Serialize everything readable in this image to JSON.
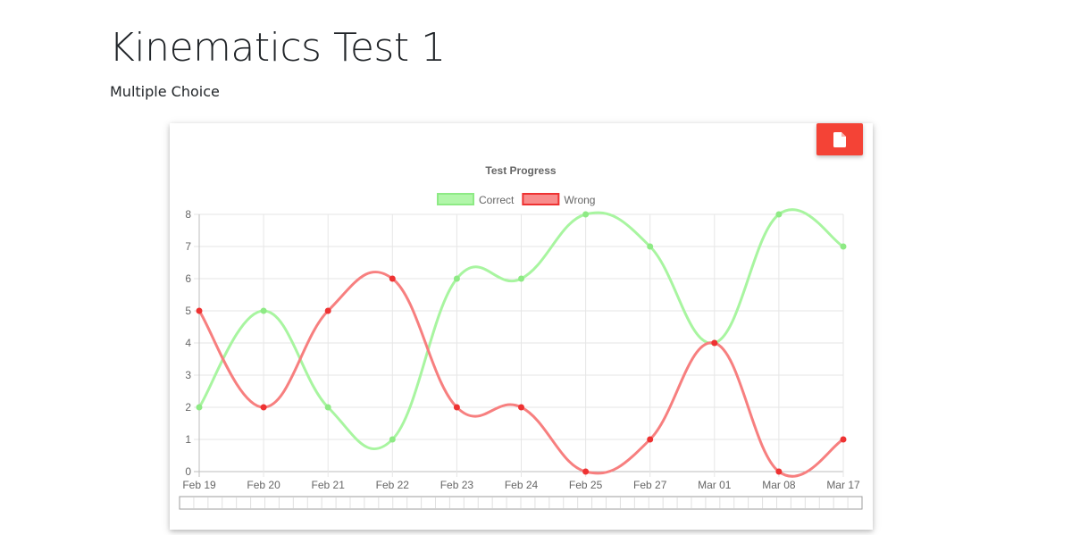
{
  "page": {
    "title": "Kinematics Test 1",
    "subtitle": "Multiple Choice"
  },
  "export_button": {
    "icon": "file-icon",
    "color": "#f44336"
  },
  "chart_data": {
    "type": "line",
    "title": "Test Progress",
    "categories": [
      "Feb 19",
      "Feb 20",
      "Feb 21",
      "Feb 22",
      "Feb 23",
      "Feb 24",
      "Feb 25",
      "Feb 27",
      "Mar 01",
      "Mar 08",
      "Mar 17"
    ],
    "series": [
      {
        "name": "Correct",
        "values": [
          2,
          5,
          2,
          1,
          6,
          6,
          8,
          7,
          4,
          8,
          7
        ],
        "line_color": "#a8f5a0",
        "point_color": "#8eea85"
      },
      {
        "name": "Wrong",
        "values": [
          5,
          2,
          5,
          6,
          2,
          2,
          0,
          1,
          4,
          0,
          1
        ],
        "line_color": "#f77f7f",
        "point_color": "#ee3232"
      }
    ],
    "ylim": [
      0,
      8
    ],
    "yticks": [
      "0",
      "1",
      "2",
      "3",
      "4",
      "5",
      "6",
      "7",
      "8"
    ],
    "grid": true,
    "legend": "top-center",
    "has_range_slider": true
  }
}
